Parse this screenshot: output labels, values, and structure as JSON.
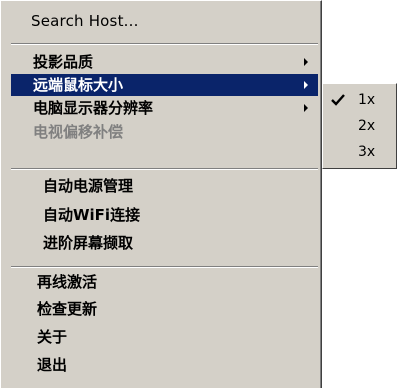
{
  "menu": {
    "search_host": "Search Host...",
    "items_group1": [
      {
        "label": "投影品质",
        "has_submenu": true,
        "selected": false,
        "disabled": false
      },
      {
        "label": "远端鼠标大小",
        "has_submenu": true,
        "selected": true,
        "disabled": false
      },
      {
        "label": "电脑显示器分辨率",
        "has_submenu": true,
        "selected": false,
        "disabled": false
      },
      {
        "label": "电视偏移补偿",
        "has_submenu": false,
        "selected": false,
        "disabled": true
      }
    ],
    "items_group2": [
      {
        "label": "自动电源管理"
      },
      {
        "label": "自动WiFi连接"
      },
      {
        "label": "进阶屏幕撷取"
      }
    ],
    "items_group3": [
      {
        "label": "再线激活"
      },
      {
        "label": "检查更新"
      },
      {
        "label": "关于"
      },
      {
        "label": "退出"
      }
    ]
  },
  "submenu": {
    "items": [
      {
        "label": "1x",
        "checked": true
      },
      {
        "label": "2x",
        "checked": false
      },
      {
        "label": "3x",
        "checked": false
      }
    ]
  },
  "colors": {
    "menu_bg": "#d4d0c8",
    "highlight": "#0a246a",
    "disabled_text": "#808080"
  }
}
